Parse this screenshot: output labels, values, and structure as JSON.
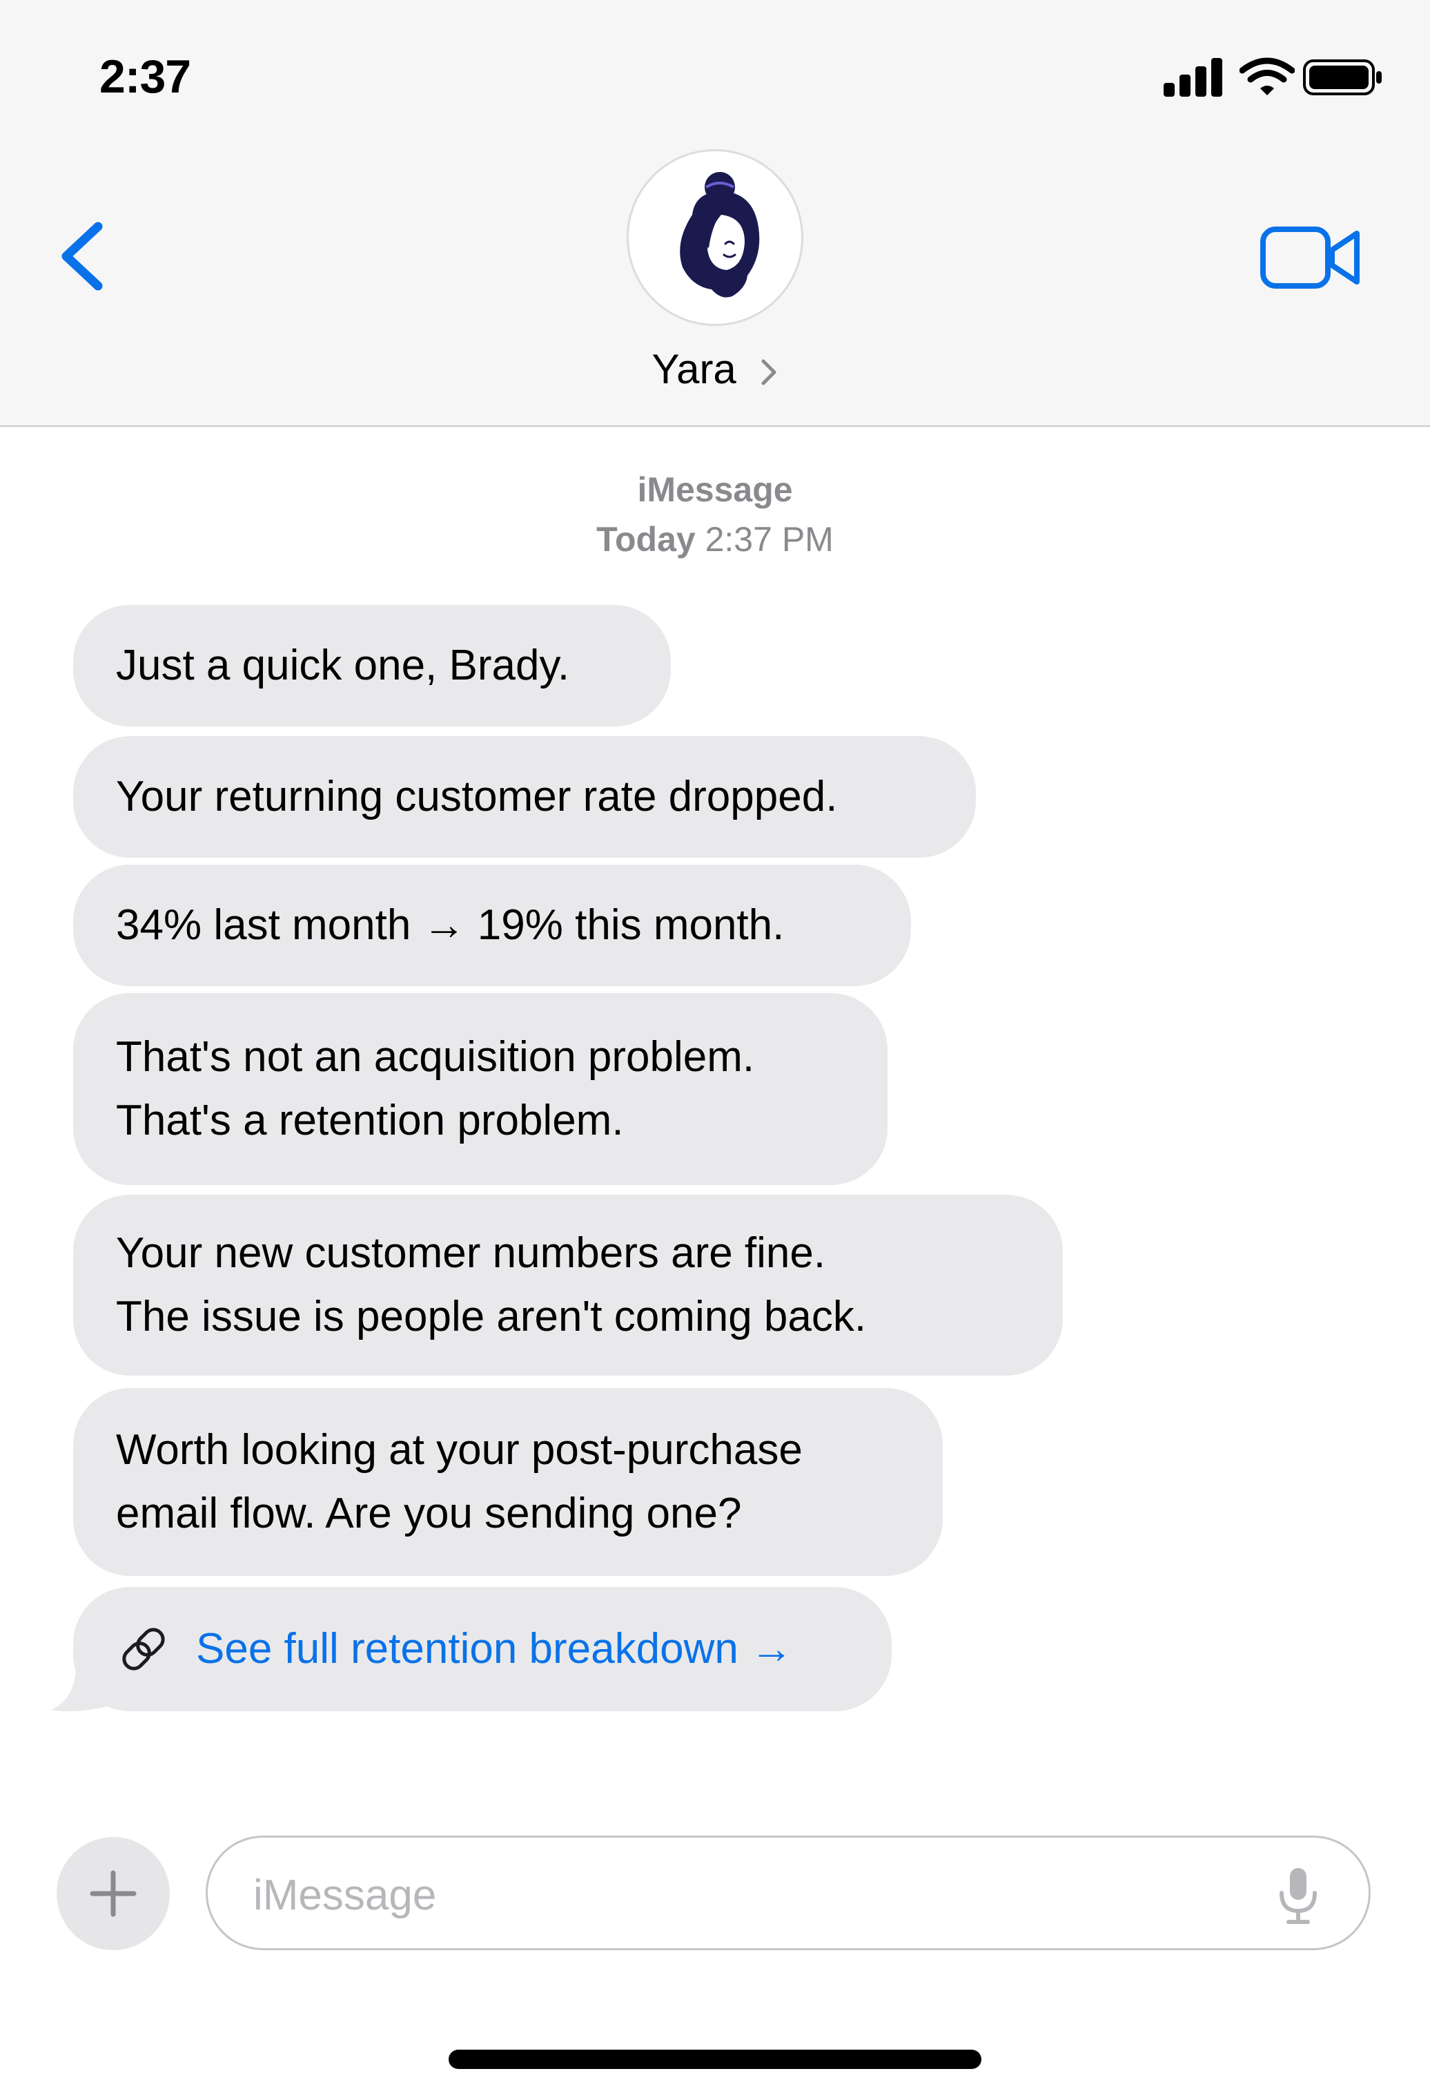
{
  "status_bar": {
    "time": "2:37",
    "icons": [
      "signal-icon",
      "wifi-icon",
      "battery-icon"
    ]
  },
  "header": {
    "back_icon": "chevron-left-icon",
    "contact_name": "Yara",
    "contact_chevron": "chevron-right-icon",
    "video_icon": "video-camera-icon",
    "avatar": "avatar-illustration"
  },
  "conversation": {
    "service": "iMessage",
    "date_label": "Today",
    "time_label": "2:37 PM",
    "messages": [
      {
        "text": "Just a quick one, Brady."
      },
      {
        "text": "Your returning customer rate dropped."
      },
      {
        "text": "34% last month → 19% this month."
      },
      {
        "text": "That's not an acquisition problem.\nThat's a retention problem."
      },
      {
        "text": "Your new customer numbers are fine.\nThe issue is people aren't coming back."
      },
      {
        "text": "Worth looking at your post-purchase\nemail flow. Are you sending one?"
      }
    ],
    "link": {
      "icon": "link-icon",
      "label": "See full retention breakdown →"
    }
  },
  "composer": {
    "plus_icon": "plus-icon",
    "placeholder": "iMessage",
    "value": "",
    "mic_icon": "microphone-icon"
  },
  "colors": {
    "accent": "#0a72e8",
    "bubble": "#e9e9eb",
    "secondary_text": "#8a8a8e",
    "header_bg": "#f6f6f7"
  }
}
